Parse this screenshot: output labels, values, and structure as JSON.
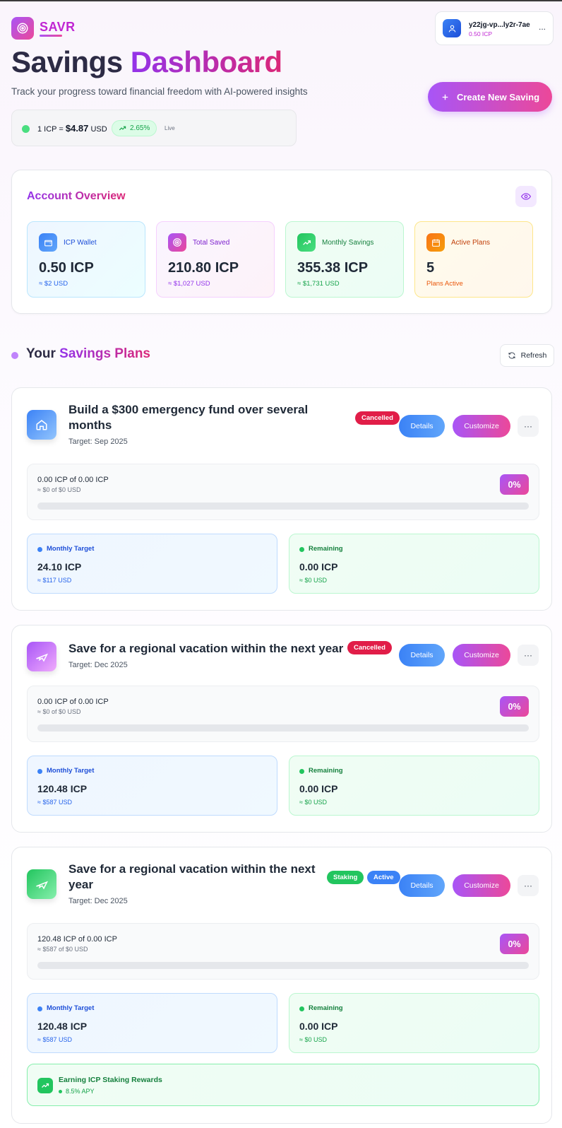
{
  "brand": "SAVR",
  "header": {
    "title_prefix": "Savings",
    "title_accent": "Dashboard",
    "subtitle": "Track your progress toward financial freedom with AI-powered insights"
  },
  "user": {
    "id": "y22jg-vp...ly2r-7ae",
    "balance": "0.50 ICP",
    "more": "..."
  },
  "create_button": "Create New Saving",
  "price": {
    "label": "1 ICP = ",
    "value": "$4.87",
    "unit": "USD",
    "change": "2.65%",
    "live": "Live"
  },
  "overview": {
    "title": "Account Overview",
    "stats": [
      {
        "label": "ICP Wallet",
        "value": "0.50 ICP",
        "sub": "≈ $2 USD"
      },
      {
        "label": "Total Saved",
        "value": "210.80 ICP",
        "sub": "≈ $1,027 USD"
      },
      {
        "label": "Monthly Savings",
        "value": "355.38 ICP",
        "sub": "≈ $1,731 USD"
      },
      {
        "label": "Active Plans",
        "value": "5",
        "sub": "Plans Active"
      }
    ]
  },
  "plans_section": {
    "title_prefix": "Your",
    "title_accent": "Savings Plans",
    "refresh": "Refresh"
  },
  "plans": [
    {
      "title": "Build a $300 emergency fund over several months",
      "target": "Target: Sep 2025",
      "badges": [
        "Cancelled"
      ],
      "details": "Details",
      "customize": "Customize",
      "more": "···",
      "progress_amount": "0.00 ICP of 0.00 ICP",
      "progress_usd": "≈ $0 of $0 USD",
      "percent": "0%",
      "progress_fraction": 0,
      "monthly_label": "Monthly Target",
      "monthly_value": "24.10 ICP",
      "monthly_usd": "≈ $117 USD",
      "remaining_label": "Remaining",
      "remaining_value": "0.00 ICP",
      "remaining_usd": "≈ $0 USD"
    },
    {
      "title": "Save for a regional vacation within the next year",
      "target": "Target: Dec 2025",
      "badges": [
        "Cancelled"
      ],
      "details": "Details",
      "customize": "Customize",
      "more": "···",
      "progress_amount": "0.00 ICP of 0.00 ICP",
      "progress_usd": "≈ $0 of $0 USD",
      "percent": "0%",
      "progress_fraction": 0,
      "monthly_label": "Monthly Target",
      "monthly_value": "120.48 ICP",
      "monthly_usd": "≈ $587 USD",
      "remaining_label": "Remaining",
      "remaining_value": "0.00 ICP",
      "remaining_usd": "≈ $0 USD"
    },
    {
      "title": "Save for a regional vacation within the next year",
      "target": "Target: Dec 2025",
      "badges": [
        "Staking",
        "Active"
      ],
      "details": "Details",
      "customize": "Customize",
      "more": "···",
      "progress_amount": "120.48 ICP of 0.00 ICP",
      "progress_usd": "≈ $587 of $0 USD",
      "percent": "0%",
      "progress_fraction": 0,
      "monthly_label": "Monthly Target",
      "monthly_value": "120.48 ICP",
      "monthly_usd": "≈ $587 USD",
      "remaining_label": "Remaining",
      "remaining_value": "0.00 ICP",
      "remaining_usd": "≈ $0 USD",
      "staking_title": "Earning ICP Staking Rewards",
      "staking_apy": "8.5% APY"
    }
  ],
  "colors": {
    "brand_purple": "#a855f7",
    "brand_pink": "#ec4899",
    "cancelled": "#e11d48",
    "staking": "#22c55e",
    "active": "#3b82f6"
  }
}
